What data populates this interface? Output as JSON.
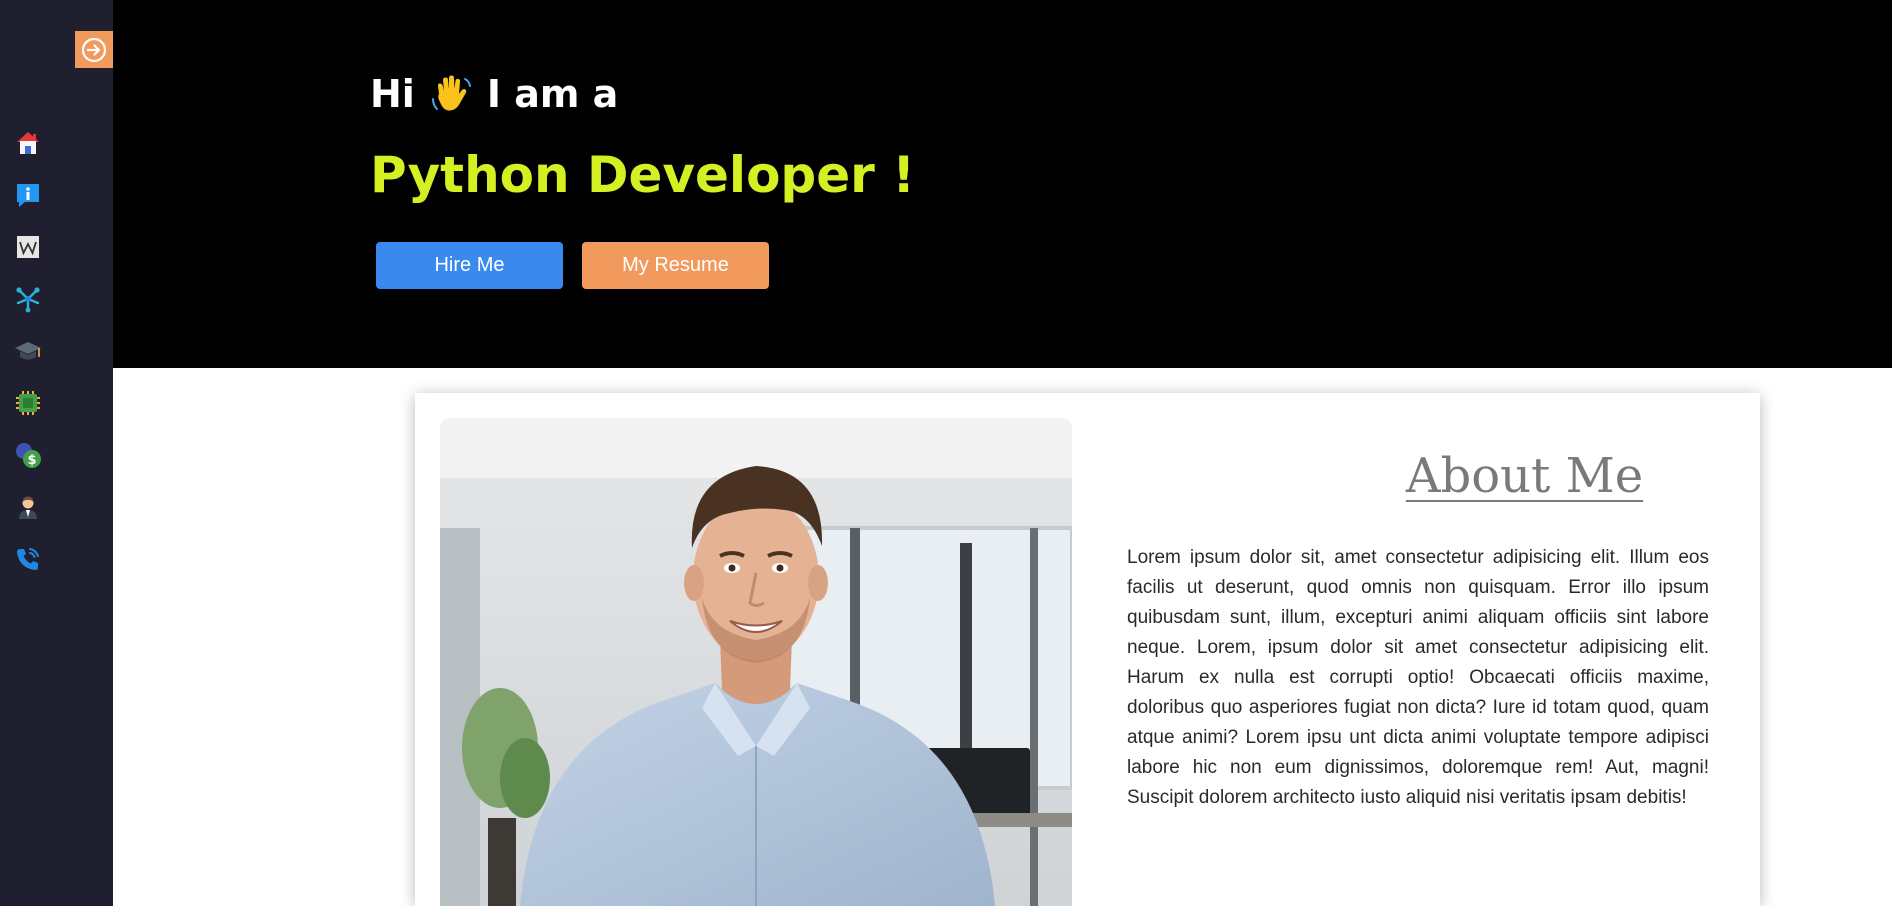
{
  "sidebar": {
    "toggle_icon": "arrow-right-circle-icon",
    "items": [
      {
        "name": "home",
        "icon": "home-icon"
      },
      {
        "name": "about",
        "icon": "info-icon"
      },
      {
        "name": "wiki",
        "icon": "wikipedia-icon"
      },
      {
        "name": "skills",
        "icon": "network-icon"
      },
      {
        "name": "education",
        "icon": "graduation-cap-icon"
      },
      {
        "name": "projects",
        "icon": "chip-icon"
      },
      {
        "name": "pricing",
        "icon": "dollar-icon"
      },
      {
        "name": "team",
        "icon": "person-icon"
      },
      {
        "name": "contact",
        "icon": "phone-icon"
      }
    ]
  },
  "hero": {
    "greeting_prefix": "Hi",
    "greeting_suffix": "I am a",
    "role": "Python Developer !",
    "hire_label": "Hire Me",
    "resume_label": "My Resume"
  },
  "about": {
    "title": "About Me",
    "body": "Lorem ipsum dolor sit, amet consectetur adipisicing elit. Illum eos facilis ut deserunt, quod omnis non quisquam. Error illo ipsum quibusdam sunt, illum, excepturi animi aliquam officiis sint labore neque. Lorem, ipsum dolor sit amet consectetur adipisicing elit. Harum ex nulla est corrupti optio! Obcaecati officiis maxime, doloribus quo asperiores fugiat non dicta? Iure id totam quod, quam atque animi? Lorem ipsu unt dicta animi voluptate tempore adipisci labore hic non eum dignissimos, doloremque rem! Aut, magni! Suscipit dolorem architecto iusto aliquid nisi veritatis ipsam debitis!"
  },
  "colors": {
    "sidebar_bg": "#1f1f30",
    "hero_bg": "#000000",
    "accent_orange": "#f29a5d",
    "accent_blue": "#3a89ee",
    "role_yellow": "#d4f023"
  }
}
